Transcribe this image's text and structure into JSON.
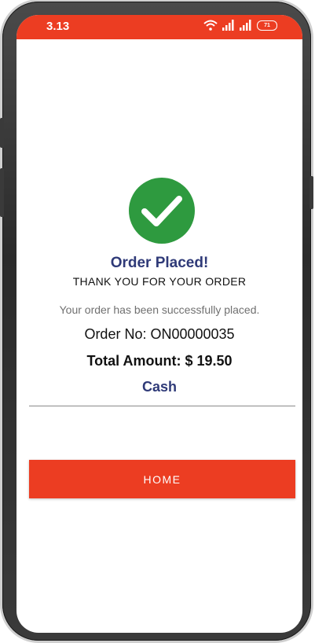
{
  "status_bar": {
    "time": "3.13",
    "battery_level": "71",
    "icons": [
      "wifi-icon",
      "signal-icon",
      "signal-icon",
      "battery-icon"
    ]
  },
  "confirmation": {
    "icon": "check-circle-icon",
    "title": "Order Placed!",
    "subtitle": "THANK YOU FOR YOUR ORDER",
    "message": "Your order has been successfully placed.",
    "order_no": "Order No: ON00000035",
    "total": "Total Amount: $ 19.50",
    "payment_method": "Cash"
  },
  "actions": {
    "home_label": "HOME"
  },
  "colors": {
    "accent": "#ec3d22",
    "success": "#2e9a3f",
    "heading": "#2f3a78"
  }
}
